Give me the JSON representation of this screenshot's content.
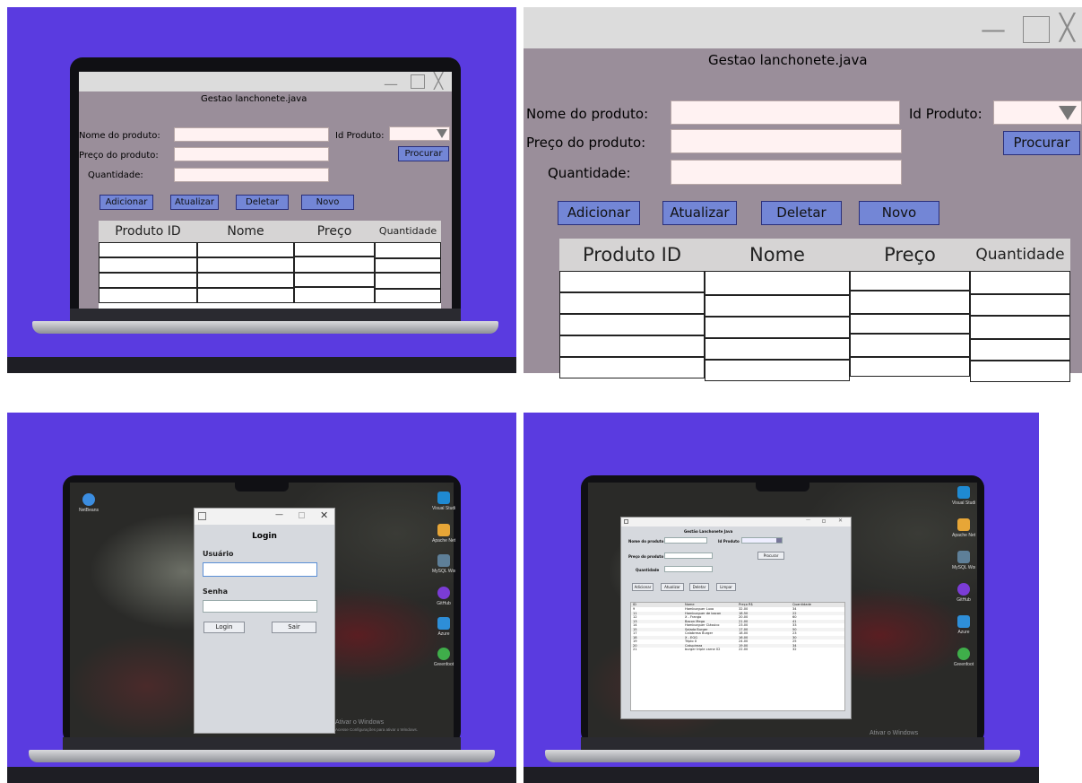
{
  "app": {
    "title": "Gestao lanchonete.java",
    "labels": {
      "nome": "Nome do produto:",
      "preco": "Preço do produto:",
      "quantidade": "Quantidade:",
      "id_produto": "Id Produto:"
    },
    "buttons": {
      "procurar": "Procurar",
      "adicionar": "Adicionar",
      "atualizar": "Atualizar",
      "deletar": "Deletar",
      "novo": "Novo"
    },
    "table_headers": [
      "Produto ID",
      "Nome",
      "Preço",
      "Quantidade"
    ]
  },
  "login": {
    "title": "Login",
    "usuario_label": "Usuário",
    "senha_label": "Senha",
    "login_button": "Login",
    "sair_button": "Sair"
  },
  "desktop": {
    "icons_left": [
      {
        "label": "NetBeans",
        "icon": "netbeans-icon"
      }
    ],
    "icons_right": [
      {
        "label": "Visual Studio Code",
        "icon": "vscode-icon"
      },
      {
        "label": "Apache NetBeans",
        "icon": "netbeans-icon"
      },
      {
        "label": "MySQL Workbench",
        "icon": "mysql-icon"
      },
      {
        "label": "GitHub",
        "icon": "github-icon"
      },
      {
        "label": "Azure",
        "icon": "azure-icon"
      },
      {
        "label": "Greenfoot",
        "icon": "greenfoot-icon"
      }
    ],
    "activate_windows": "Ativar o Windows",
    "activate_windows_hint": "Acesse Configurações para ativar o Windows."
  },
  "mini_app": {
    "title": "Gestão Lanchonete Java",
    "labels": {
      "nome": "Nome do produto",
      "id": "Id Produto",
      "preco": "Preço do produto",
      "quantidade": "Quantidade"
    },
    "buttons": {
      "procurar": "Procurar",
      "adicionar": "Adicionar",
      "atualizar": "Atualizar",
      "deletar": "Deletar",
      "limpar": "Limpar"
    },
    "headers": [
      "ID",
      "Nome",
      "Preço R$",
      "Quantidade"
    ],
    "rows": [
      [
        "9",
        "Hamburguer Luxo",
        "32.00",
        "34"
      ],
      [
        "11",
        "Hamburguer de bacon",
        "18.50",
        "22"
      ],
      [
        "12",
        "X - Frango",
        "20.00",
        "60"
      ],
      [
        "13",
        "Bacon Mega",
        "21.00",
        "41"
      ],
      [
        "14",
        "Hamburguer Clássico",
        "23.00",
        "33"
      ],
      [
        "15",
        "Salada Burger",
        "17.00",
        "50"
      ],
      [
        "17",
        "Calabresa Burger",
        "18.00",
        "23"
      ],
      [
        "18",
        "X - EGG",
        "16.00",
        "30"
      ],
      [
        "19",
        "Triplo X",
        "24.00",
        "25"
      ],
      [
        "20",
        "Catupireza",
        "19.00",
        "34"
      ],
      [
        "21",
        "burger triple carne 02",
        "22.00",
        "32"
      ]
    ]
  },
  "colors": {
    "purple_bg": "#5a3be0",
    "app_bg": "#9a8e9a",
    "field_bg": "#fff2f2",
    "button_bg": "#7386d6"
  }
}
